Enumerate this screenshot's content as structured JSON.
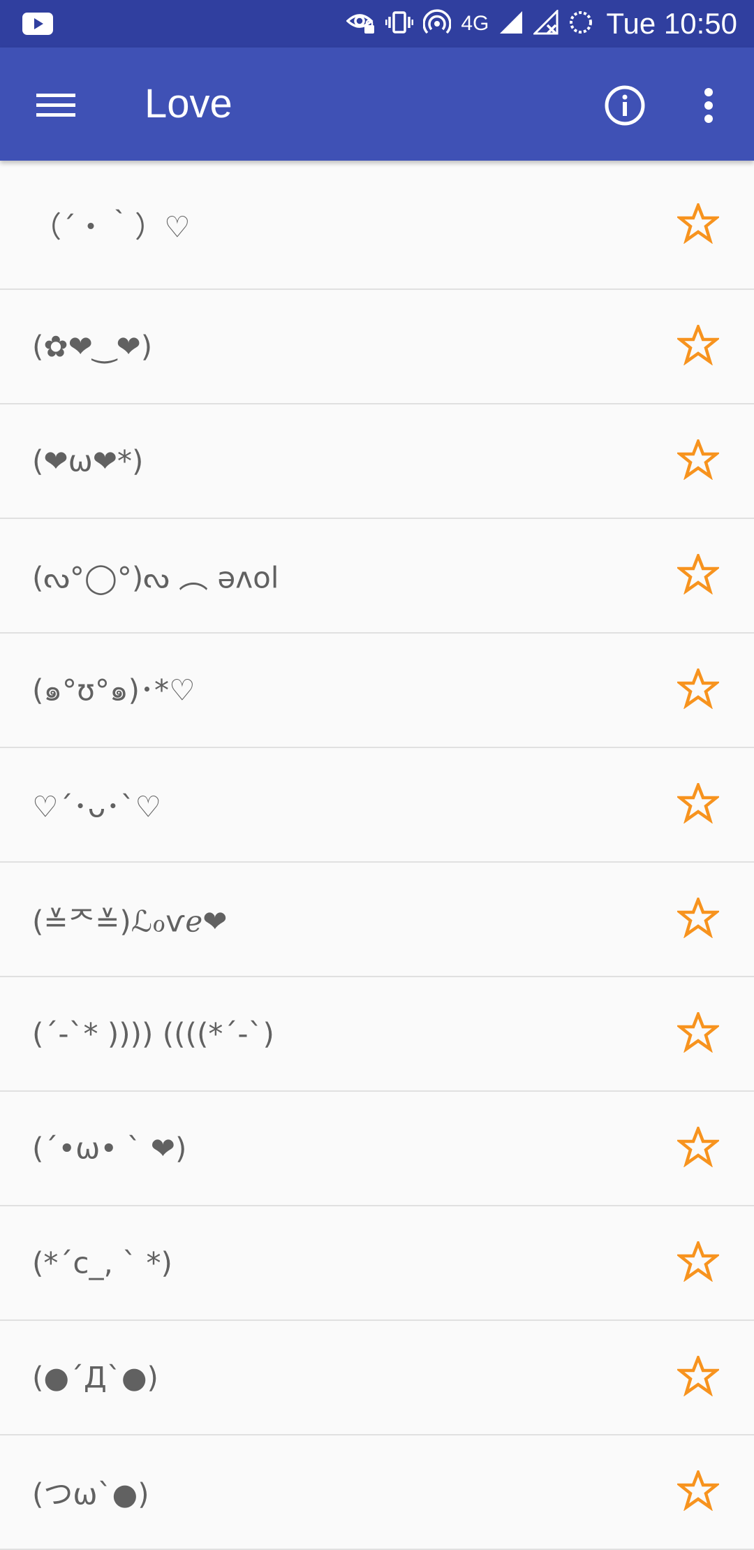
{
  "status_bar": {
    "network": "4G",
    "time": "Tue 10:50",
    "icons": [
      "youtube-icon",
      "eye-lock-icon",
      "vibrate-icon",
      "hotspot-icon",
      "signal-icon",
      "signal-off-icon",
      "sync-icon"
    ]
  },
  "app_bar": {
    "title": "Love",
    "icons": [
      "menu-icon",
      "info-icon",
      "more-vert-icon"
    ]
  },
  "colors": {
    "status_bar": "#303f9f",
    "app_bar": "#3f51b5",
    "star": "#f7931e",
    "text": "#616161",
    "divider": "#e0e0e0"
  },
  "items": [
    {
      "text": "（´・｀）♡"
    },
    {
      "text": "(✿❤‿❤)"
    },
    {
      "text": "(❤ω❤*)"
    },
    {
      "text": "(ᔓ°◯°)ᔓ ︵ ǝʌol"
    },
    {
      "text": "(๑°ʊ°๑)･*♡"
    },
    {
      "text": "♡´･ᴗ･`♡"
    },
    {
      "text": "(≚ᄌ≚)ℒℴѵℯ❤"
    },
    {
      "text": "(´-`* )))) ((((*´-`)"
    },
    {
      "text": "(´•ω• ` ❤)"
    },
    {
      "text": "(*´c_, ` *)"
    },
    {
      "text": "(●´Д`●)"
    },
    {
      "text": "(つω`●)"
    }
  ]
}
